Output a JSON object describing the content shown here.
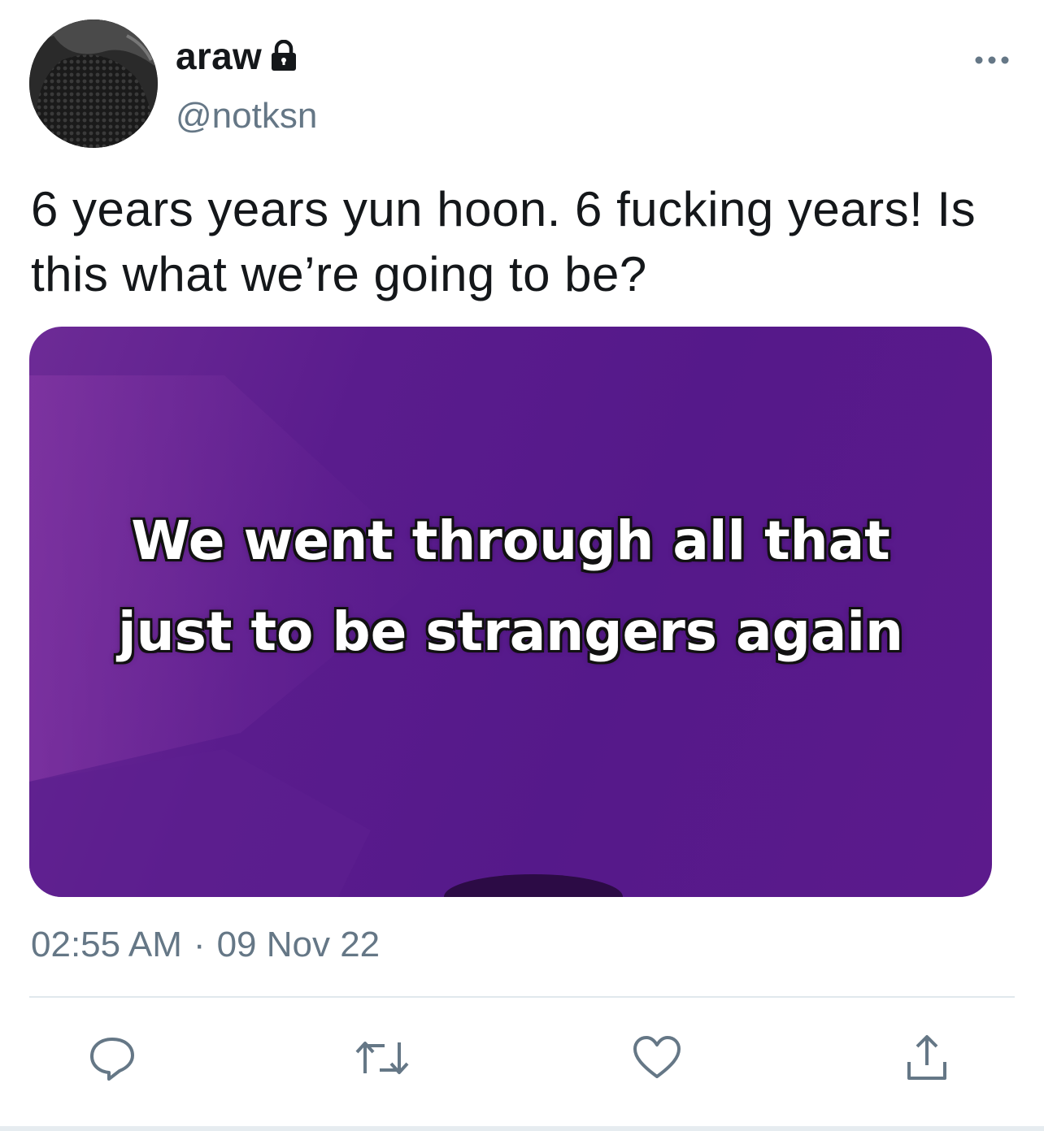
{
  "user": {
    "display_name": "araw",
    "handle": "@notksn",
    "protected_icon": "lock-icon",
    "avatar_icon": "avatar-photo"
  },
  "tweet": {
    "text": "6 years years yun hoon. 6 fucking years! Is this what we’re going to be?",
    "media": {
      "caption_lines": [
        "We went through all that",
        "just to be strangers again"
      ],
      "background_color": "#5a1c8d"
    },
    "time": "02:55 AM",
    "separator": "·",
    "date": "09 Nov 22"
  },
  "menu": {
    "more_icon": "more-horizontal-icon"
  },
  "actions": [
    {
      "icon": "reply-icon"
    },
    {
      "icon": "retweet-icon"
    },
    {
      "icon": "like-icon"
    },
    {
      "icon": "share-icon"
    }
  ],
  "colors": {
    "text_primary": "#14171a",
    "text_secondary": "#657786",
    "divider": "#e1e8ed"
  }
}
